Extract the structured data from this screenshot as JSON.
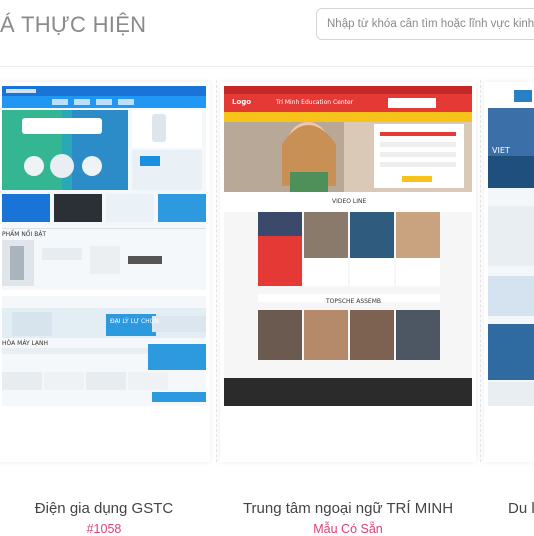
{
  "section": {
    "title": "Á THỰC HIỆN"
  },
  "search": {
    "placeholder": "Nhập từ khóa cần tìm hoặc lĩnh vực kinh doa"
  },
  "templates": [
    {
      "name": "Điện gia dụng GSTC",
      "code": "#1058",
      "thumb_texts": [
        "PHẨM NỔI BẬT",
        "HÒA MÁY LẠNH",
        "ĐẠI LÝ LỰ CHỌN"
      ]
    },
    {
      "name": "Trung tâm ngoại ngữ TRÍ MINH",
      "code": "Mẫu Có Sẵn",
      "thumb_texts": [
        "Logo",
        "Trí Minh Education Center",
        "VIDEO LINE",
        "TOPSCHE ASSEMB"
      ]
    },
    {
      "name": "Du lị",
      "code": "",
      "thumb_texts": [
        "VIET"
      ]
    }
  ],
  "colors": {
    "accent_pink": "#e0407a",
    "blue": "#1a8fe0",
    "red": "#d32f2f",
    "yellow": "#f7c21a"
  }
}
